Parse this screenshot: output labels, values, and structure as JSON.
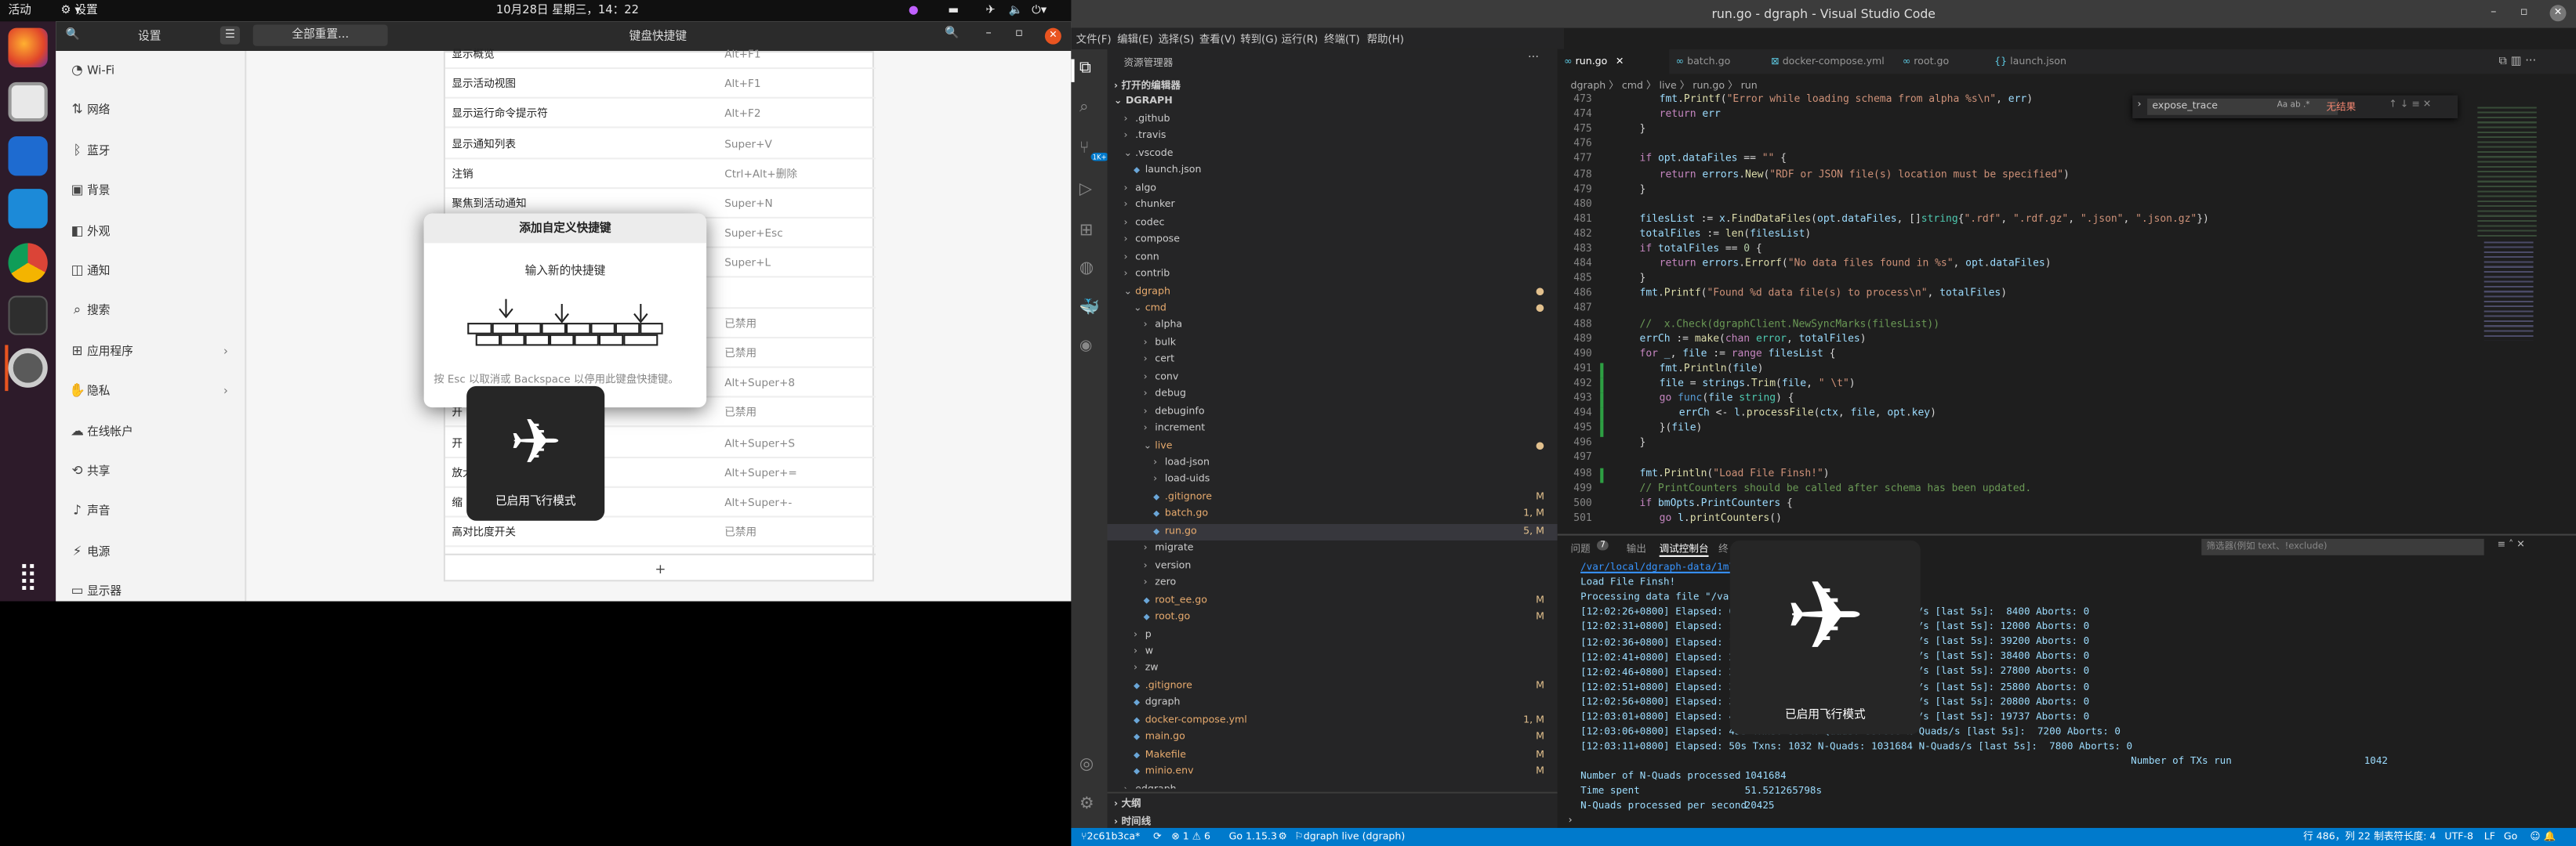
{
  "topbar": {
    "activities": "活动",
    "app_menu": "设置",
    "clock": "10月28日 星期三，14：22"
  },
  "settings": {
    "header_title": "设置",
    "reset_button": "全部重置...",
    "panel_title": "键盘快捷键",
    "nav": [
      {
        "icon": "wifi-icon",
        "label": "Wi-Fi"
      },
      {
        "icon": "network-icon",
        "label": "网络"
      },
      {
        "icon": "bluetooth-icon",
        "label": "蓝牙"
      },
      {
        "icon": "background-icon",
        "label": "背景"
      },
      {
        "icon": "appearance-icon",
        "label": "外观"
      },
      {
        "icon": "notification-icon",
        "label": "通知"
      },
      {
        "icon": "search-icon",
        "label": "搜索"
      },
      {
        "icon": "apps-icon",
        "label": "应用程序"
      },
      {
        "icon": "privacy-icon",
        "label": "隐私"
      },
      {
        "icon": "online-accounts-icon",
        "label": "在线帐户"
      },
      {
        "icon": "share-icon",
        "label": "共享"
      },
      {
        "icon": "sound-icon",
        "label": "声音"
      },
      {
        "icon": "power-icon",
        "label": "电源"
      },
      {
        "icon": "display-icon",
        "label": "显示器"
      }
    ],
    "shortcuts": [
      {
        "name": "显示概览",
        "shortcut": "Alt+F1"
      },
      {
        "name": "显示活动视图",
        "shortcut": "Alt+F1"
      },
      {
        "name": "显示运行命令提示符",
        "shortcut": "Alt+F2"
      },
      {
        "name": "显示通知列表",
        "shortcut": "Super+V"
      },
      {
        "name": "注销",
        "shortcut": "Ctrl+Alt+删除"
      },
      {
        "name": "聚焦到活动通知",
        "shortcut": "Super+N"
      },
      {
        "name": "",
        "shortcut": "Super+Esc"
      },
      {
        "name": "",
        "shortcut": "Super+L"
      },
      {
        "name": "",
        "shortcut": ""
      },
      {
        "name": "",
        "shortcut": "已禁用"
      },
      {
        "name": "",
        "shortcut": "已禁用"
      },
      {
        "name": "",
        "shortcut": "Alt+Super+8"
      },
      {
        "name": "开",
        "shortcut": "已禁用"
      },
      {
        "name": "开",
        "shortcut": "Alt+Super+S"
      },
      {
        "name": "放大",
        "shortcut": "Alt+Super+="
      },
      {
        "name": "缩",
        "shortcut": "Alt+Super+-"
      },
      {
        "name": "高对比度开关",
        "shortcut": "已禁用"
      }
    ],
    "add_row": "+"
  },
  "dialog": {
    "title": "添加自定义快捷键",
    "prompt": "输入新的快捷键",
    "hint": "按 Esc 以取消或 Backspace 以停用此键盘快捷键。"
  },
  "osd_left": "已启用飞行模式",
  "osd_right": "已启用飞行模式",
  "vscode": {
    "title": "run.go - dgraph - Visual Studio Code",
    "menu": [
      "文件(F)",
      "编辑(E)",
      "选择(S)",
      "查看(V)",
      "转到(G)",
      "运行(R)",
      "终端(T)",
      "帮助(H)"
    ],
    "tabs": [
      "run.go",
      "batch.go",
      "docker-compose.yml",
      "root.go",
      "launch.json"
    ],
    "breadcrumb": "dgraph 〉 cmd 〉 live 〉 run.go 〉 run",
    "find": {
      "value": "expose_trace",
      "result": "无结果"
    },
    "explorer": {
      "header": "资源管理器",
      "open_editors": "打开的编辑器",
      "root": "DGRAPH",
      "outline": "大纲",
      "timeline": "时间线"
    },
    "tree": [
      {
        "t": ".github",
        "i": 1,
        "f": false
      },
      {
        "t": ".travis",
        "i": 1,
        "f": false
      },
      {
        "t": ".vscode",
        "i": 1,
        "f": false,
        "open": true
      },
      {
        "t": "launch.json",
        "i": 2,
        "f": true
      },
      {
        "t": "algo",
        "i": 1,
        "f": false
      },
      {
        "t": "chunker",
        "i": 1,
        "f": false
      },
      {
        "t": "codec",
        "i": 1,
        "f": false
      },
      {
        "t": "compose",
        "i": 1,
        "f": false
      },
      {
        "t": "conn",
        "i": 1,
        "f": false
      },
      {
        "t": "contrib",
        "i": 1,
        "f": false
      },
      {
        "t": "dgraph",
        "i": 1,
        "f": false,
        "open": true,
        "c": "#e8ab6e"
      },
      {
        "t": "cmd",
        "i": 2,
        "f": false,
        "open": true,
        "c": "#e8ab6e"
      },
      {
        "t": "alpha",
        "i": 3,
        "f": false
      },
      {
        "t": "bulk",
        "i": 3,
        "f": false
      },
      {
        "t": "cert",
        "i": 3,
        "f": false
      },
      {
        "t": "conv",
        "i": 3,
        "f": false
      },
      {
        "t": "debug",
        "i": 3,
        "f": false
      },
      {
        "t": "debuginfo",
        "i": 3,
        "f": false
      },
      {
        "t": "increment",
        "i": 3,
        "f": false
      },
      {
        "t": "live",
        "i": 3,
        "f": false,
        "open": true,
        "c": "#e8ab6e"
      },
      {
        "t": "load-json",
        "i": 4,
        "f": false
      },
      {
        "t": "load-uids",
        "i": 4,
        "f": false
      },
      {
        "t": ".gitignore",
        "i": 4,
        "f": true,
        "c": "#e8ab6e",
        "b": "M"
      },
      {
        "t": "batch.go",
        "i": 4,
        "f": true,
        "c": "#e8ab6e",
        "b": "1, M"
      },
      {
        "t": "run.go",
        "i": 4,
        "f": true,
        "c": "#e8ab6e",
        "b": "5, M",
        "sel": true
      },
      {
        "t": "migrate",
        "i": 3,
        "f": false
      },
      {
        "t": "version",
        "i": 3,
        "f": false
      },
      {
        "t": "zero",
        "i": 3,
        "f": false
      },
      {
        "t": "root_ee.go",
        "i": 3,
        "f": true,
        "c": "#e8ab6e",
        "b": "M"
      },
      {
        "t": "root.go",
        "i": 3,
        "f": true,
        "c": "#e8ab6e",
        "b": "M"
      },
      {
        "t": "p",
        "i": 2,
        "f": false
      },
      {
        "t": "w",
        "i": 2,
        "f": false
      },
      {
        "t": "zw",
        "i": 2,
        "f": false
      },
      {
        "t": ".gitignore",
        "i": 2,
        "f": true,
        "c": "#e8ab6e",
        "b": "M"
      },
      {
        "t": "dgraph",
        "i": 2,
        "f": true
      },
      {
        "t": "docker-compose.yml",
        "i": 2,
        "f": true,
        "c": "#e8ab6e",
        "b": "1, M"
      },
      {
        "t": "main.go",
        "i": 2,
        "f": true,
        "c": "#e8ab6e",
        "b": "M"
      },
      {
        "t": "Makefile",
        "i": 2,
        "f": true,
        "c": "#e8ab6e",
        "b": "M"
      },
      {
        "t": "minio.env",
        "i": 2,
        "f": true,
        "c": "#e8ab6e",
        "b": "M"
      },
      {
        "t": "edgraph",
        "i": 1,
        "f": false
      }
    ],
    "code": [
      {
        "n": "473",
        "h": "<span class='vr'>fmt</span>.<span class='fn'>Printf</span>(<span class='st'>\"Error while loading schema from alpha %s\\n\"</span>, <span class='vr'>err</span>)",
        "x": 24
      },
      {
        "n": "474",
        "h": "<span class='kw'>return</span> <span class='vr'>err</span>",
        "x": 24
      },
      {
        "n": "475",
        "h": "}",
        "x": 12
      },
      {
        "n": "476",
        "h": "",
        "x": 12
      },
      {
        "n": "477",
        "h": "<span class='kw'>if</span> <span class='vr'>opt</span>.<span class='vr'>dataFiles</span> == <span class='st'>\"\"</span> {",
        "x": 12
      },
      {
        "n": "478",
        "h": "<span class='kw'>return</span> <span class='vr'>errors</span>.<span class='fn'>New</span>(<span class='st'>\"RDF or JSON file(s) location must be specified\"</span>)",
        "x": 24
      },
      {
        "n": "479",
        "h": "}",
        "x": 12
      },
      {
        "n": "480",
        "h": "",
        "x": 12
      },
      {
        "n": "481",
        "h": "<span class='vr'>filesList</span> := <span class='vr'>x</span>.<span class='fn'>FindDataFiles</span>(<span class='vr'>opt</span>.<span class='vr'>dataFiles</span>, []<span class='ty'>string</span>{<span class='st'>\".rdf\"</span>, <span class='st'>\".rdf.gz\"</span>, <span class='st'>\".json\"</span>, <span class='st'>\".json.gz\"</span>})",
        "x": 12
      },
      {
        "n": "482",
        "h": "<span class='vr'>totalFiles</span> := <span class='fn'>len</span>(<span class='vr'>filesList</span>)",
        "x": 12
      },
      {
        "n": "483",
        "h": "<span class='kw'>if</span> <span class='vr'>totalFiles</span> == <span class='nm'>0</span> {",
        "x": 12
      },
      {
        "n": "484",
        "h": "<span class='kw'>return</span> <span class='vr'>errors</span>.<span class='fn'>Errorf</span>(<span class='st'>\"No data files found in %s\"</span>, <span class='vr'>opt</span>.<span class='vr'>dataFiles</span>)",
        "x": 24
      },
      {
        "n": "485",
        "h": "}",
        "x": 12
      },
      {
        "n": "486",
        "h": "<span class='vr'>fmt</span>.<span class='fn'>Printf</span>(<span class='st'>\"Found %d data file(s) to process\\n\"</span>, <span class='vr'>totalFiles</span>)",
        "x": 12
      },
      {
        "n": "487",
        "h": "",
        "x": 12
      },
      {
        "n": "488",
        "h": "<span class='cm'>//  x.Check(dgraphClient.NewSyncMarks(filesList))</span>",
        "x": 12
      },
      {
        "n": "489",
        "h": "<span class='vr'>errCh</span> := <span class='fn'>make</span>(<span class='kw'>chan</span> <span class='ty'>error</span>, <span class='vr'>totalFiles</span>)",
        "x": 12
      },
      {
        "n": "490",
        "h": "<span class='kw'>for</span> <span class='vr'>_</span>, <span class='vr'>file</span> := <span class='kw'>range</span> <span class='vr'>filesList</span> {",
        "x": 12
      },
      {
        "n": "491",
        "h": "<span class='vr'>fmt</span>.<span class='fn'>Println</span>(<span class='vr'>file</span>)",
        "x": 24
      },
      {
        "n": "492",
        "h": "<span class='vr'>file</span> = <span class='vr'>strings</span>.<span class='fn'>Trim</span>(<span class='vr'>file</span>, <span class='st'>\" \\t\"</span>)",
        "x": 24
      },
      {
        "n": "493",
        "h": "<span class='kw'>go</span> <span class='bl'>func</span>(<span class='vr'>file</span> <span class='ty'>string</span>) {",
        "x": 24
      },
      {
        "n": "494",
        "h": "<span class='vr'>errCh</span> &lt;- <span class='vr'>l</span>.<span class='fn'>processFile</span>(<span class='vr'>ctx</span>, <span class='vr'>file</span>, <span class='vr'>opt</span>.<span class='vr'>key</span>)",
        "x": 36
      },
      {
        "n": "495",
        "h": "}(<span class='vr'>file</span>)",
        "x": 24
      },
      {
        "n": "496",
        "h": "}",
        "x": 12
      },
      {
        "n": "497",
        "h": "",
        "x": 12
      },
      {
        "n": "498",
        "h": "<span class='vr'>fmt</span>.<span class='fn'>Println</span>(<span class='st'>\"Load File Finsh!\"</span>)",
        "x": 12
      },
      {
        "n": "499",
        "h": "<span class='cm'>// PrintCounters should be called after schema has been updated.</span>",
        "x": 12
      },
      {
        "n": "500",
        "h": "<span class='kw'>if</span> <span class='vr'>bmOpts</span>.<span class='vr'>PrintCounters</span> {",
        "x": 12
      },
      {
        "n": "501",
        "h": "<span class='kw'>go</span> <span class='vr'>l</span>.<span class='fn'>printCounters</span>()",
        "x": 24
      }
    ],
    "panel_tabs": [
      "问题",
      "输出",
      "调试控制台",
      "终"
    ],
    "panel_badge": "7",
    "filter_placeholder": "筛选器(例如 text、!exclude)",
    "term": [
      "/var/local/dgraph-data/1m\\",
      "Load File Finsh!",
      "Processing data file \"/var",
      "[12:02:26+0800] Elapsed: 0",
      "[12:02:31+0800] Elapsed: 1",
      "[12:02:36+0800] Elapsed: 1",
      "[12:02:41+0800] Elapsed: 2",
      "[12:02:46+0800] Elapsed: 2",
      "[12:02:51+0800] Elapsed: 3",
      "[12:02:56+0800] Elapsed: 3",
      "[12:03:01+0800] Elapsed: 4",
      "[12:03:06+0800] Elapsed: 45s Txns: 997 N-Quads: 997000 N-Quads/s [last 5s]:  7200 Aborts: 0",
      "[12:03:11+0800] Elapsed: 50s Txns: 1032 N-Quads: 1031684 N-Quads/s [last 5s]:  7800 Aborts: 0"
    ],
    "term_right": [
      "/s [last 5s]:  8400 Aborts: 0",
      "/s [last 5s]: 12000 Aborts: 0",
      "/s [last 5s]: 39200 Aborts: 0",
      "/s [last 5s]: 38400 Aborts: 0",
      "/s [last 5s]: 27800 Aborts: 0",
      "/s [last 5s]: 25800 Aborts: 0",
      "/s [last 5s]: 20800 Aborts: 0",
      "/s [last 5s]: 19737 Aborts: 0"
    ],
    "summary": {
      "txns_label": "Number of TXs run",
      "txns": "1042",
      "nq_label": "Number of N-Quads processed",
      "nq": "1041684",
      "time_label": "Time spent",
      "time": "51.521265798s",
      "rate_label": "N-Quads processed per second",
      "rate": "20425"
    },
    "status": {
      "branch": "2c61b3ca*",
      "problems": "⊗ 1 ⚠ 6",
      "go": "Go 1.15.3",
      "launch": "dgraph live (dgraph)",
      "pos": "行 486，列 22",
      "tab": "制表符长度: 4",
      "enc": "UTF-8",
      "eol": "LF",
      "lang": "Go"
    }
  }
}
